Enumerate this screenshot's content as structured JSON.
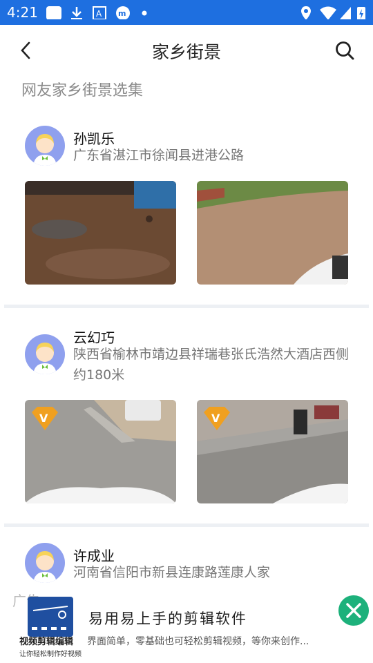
{
  "status_bar": {
    "time": "4:21"
  },
  "app_bar": {
    "title": "家乡街景",
    "back_icon": "chevron-left-icon",
    "search_icon": "search-icon"
  },
  "section": {
    "title": "网友家乡街景选集"
  },
  "posts": [
    {
      "name": "孙凯乐",
      "address": "广东省湛江市徐闻县进港公路",
      "photos": [
        "street-view-1",
        "street-view-2"
      ]
    },
    {
      "name": "云幻巧",
      "address": "陕西省榆林市靖边县祥瑞巷张氏浩然大酒店西侧约180米",
      "photos": [
        "street-view-3",
        "street-view-4"
      ],
      "badge": "V"
    },
    {
      "name": "许成业",
      "address": "河南省信阳市新县连康路莲康人家"
    }
  ],
  "ad": {
    "label": "广告",
    "headline": "易用易上手的剪辑软件",
    "subtext": "界面简单，零基础也可轻松剪辑视频，等你来创作...",
    "logo_title": "视频剪辑编辑",
    "logo_subtitle": "让你轻松制作好视频",
    "accent": "#1db17b"
  },
  "colors": {
    "status_bar": "#1e6fe0",
    "avatar_bg": "#8fa0ee",
    "divider": "#edf0f4"
  }
}
